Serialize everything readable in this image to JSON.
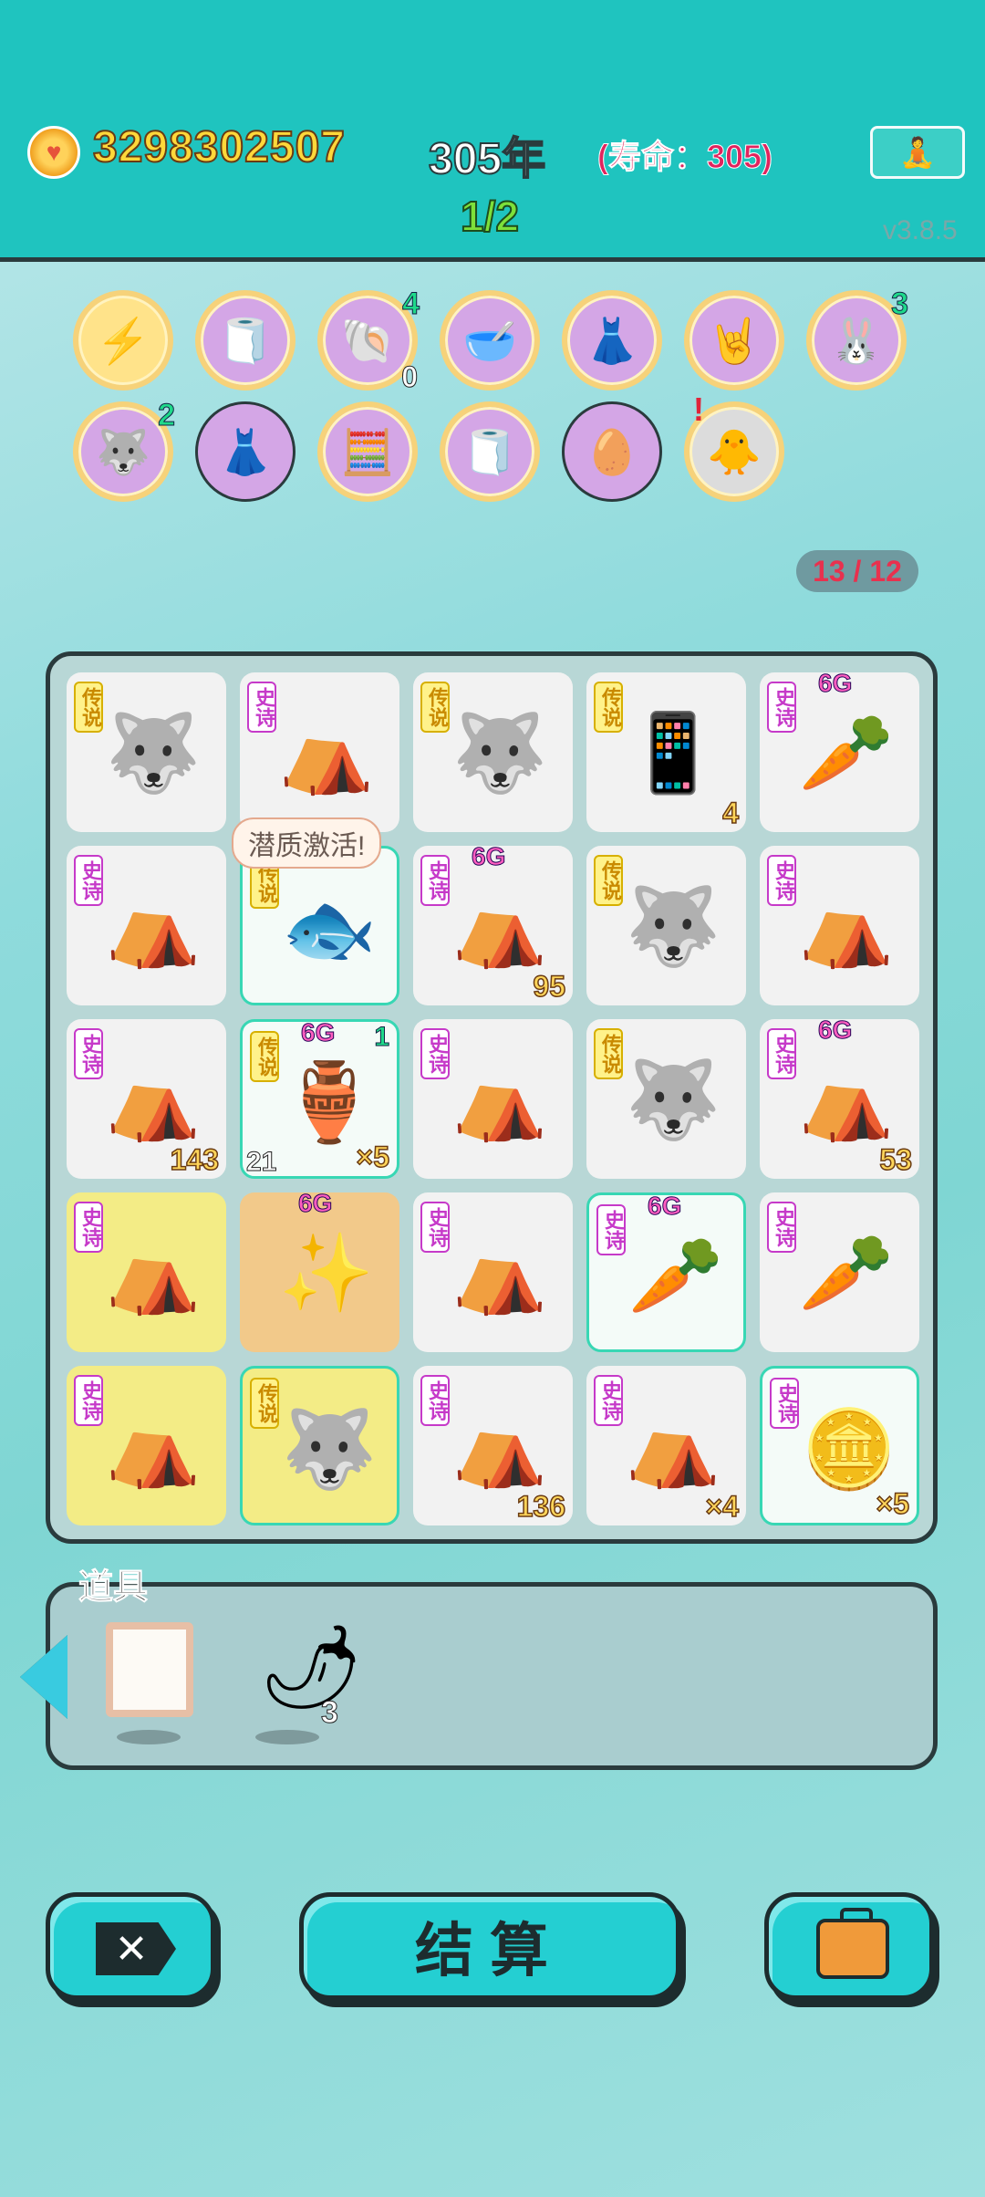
{
  "header": {
    "coins": "3298302507",
    "years": "305年",
    "lifespan": "(寿命：305)",
    "stage": "1/2",
    "version": "v3.8.5",
    "meditate_icon": "meditation-icon"
  },
  "badges": [
    {
      "icon": "lightning-icon",
      "glyph": "⚡",
      "count": "",
      "sub": ""
    },
    {
      "icon": "tissue-box-icon",
      "glyph": "🧻",
      "count": "",
      "sub": ""
    },
    {
      "icon": "shell-icon",
      "glyph": "🐚",
      "count": "4",
      "sub": "0"
    },
    {
      "icon": "bowls-icon",
      "glyph": "🥣",
      "count": "",
      "sub": ""
    },
    {
      "icon": "skirt-icon",
      "glyph": "👗",
      "count": "",
      "sub": ""
    },
    {
      "icon": "rock-hand-icon",
      "glyph": "🤘",
      "count": "",
      "sub": ""
    },
    {
      "icon": "rabbit-icon",
      "glyph": "🐰",
      "count": "3",
      "sub": ""
    },
    {
      "icon": "husky-icon",
      "glyph": "🐺",
      "count": "2",
      "sub": ""
    },
    {
      "icon": "skirt-plain-icon",
      "glyph": "👗",
      "count": "",
      "sub": ""
    },
    {
      "icon": "math-head-icon",
      "glyph": "🧮",
      "count": "",
      "sub": ""
    },
    {
      "icon": "tissue-box-plain-icon",
      "glyph": "🧻",
      "count": "",
      "sub": ""
    },
    {
      "icon": "egg-icon",
      "glyph": "🥚",
      "count": "",
      "sub": ""
    },
    {
      "icon": "chick-icon",
      "glyph": "🐥",
      "count": "",
      "sub": "",
      "alert": "!"
    }
  ],
  "slot_counter": "13 / 12",
  "board": {
    "bubble": "潜质激活!",
    "cells": [
      {
        "tag": "传说",
        "kind": "legend",
        "icon": "husky-king-icon",
        "glyph": "🐺",
        "num": "",
        "g": ""
      },
      {
        "tag": "史诗",
        "kind": "epic",
        "icon": "rabbit-tent-icon",
        "glyph": "⛺",
        "num": "",
        "g": ""
      },
      {
        "tag": "传说",
        "kind": "legend",
        "icon": "husky-king-icon",
        "glyph": "🐺",
        "num": "",
        "g": ""
      },
      {
        "tag": "传说",
        "kind": "legend",
        "icon": "phone-icon",
        "glyph": "📱",
        "num": "4",
        "g": ""
      },
      {
        "tag": "史诗",
        "kind": "epic",
        "icon": "carrot-icon",
        "glyph": "🥕",
        "num": "",
        "g": "6G"
      },
      {
        "tag": "史诗",
        "kind": "epic",
        "icon": "rabbit-tent-icon",
        "glyph": "⛺",
        "num": "",
        "g": ""
      },
      {
        "tag": "传说",
        "kind": "legend",
        "icon": "koi-fish-icon",
        "glyph": "🐟",
        "num": "",
        "g": "",
        "hl": true
      },
      {
        "tag": "史诗",
        "kind": "epic",
        "icon": "rabbit-tent-icon",
        "glyph": "⛺",
        "num": "95",
        "g": "6G"
      },
      {
        "tag": "传说",
        "kind": "legend",
        "icon": "husky-moon-icon",
        "glyph": "🐺",
        "num": "",
        "g": ""
      },
      {
        "tag": "史诗",
        "kind": "epic",
        "icon": "rabbit-tent-icon",
        "glyph": "⛺",
        "num": "",
        "g": ""
      },
      {
        "tag": "史诗",
        "kind": "epic",
        "icon": "rabbit-tent-icon",
        "glyph": "⛺",
        "num": "143",
        "g": ""
      },
      {
        "tag": "传说",
        "kind": "legend",
        "icon": "green-vase-icon",
        "glyph": "🏺",
        "num": "×5",
        "g": "6G",
        "tl": "21",
        "tr": "1",
        "hl": true
      },
      {
        "tag": "史诗",
        "kind": "epic",
        "icon": "rabbit-tent-icon",
        "glyph": "⛺",
        "num": "",
        "g": ""
      },
      {
        "tag": "传说",
        "kind": "legend",
        "icon": "husky-king-icon",
        "glyph": "🐺",
        "num": "",
        "g": ""
      },
      {
        "tag": "史诗",
        "kind": "epic",
        "icon": "rabbit-tent-icon",
        "glyph": "⛺",
        "num": "53",
        "g": "6G"
      },
      {
        "tag": "史诗",
        "kind": "epic",
        "icon": "rabbit-tent-big-icon",
        "glyph": "⛺",
        "num": "",
        "g": "",
        "bg": "yellow"
      },
      {
        "tag": "",
        "kind": "",
        "icon": "sparkle-cross-icon",
        "glyph": "✨",
        "num": "",
        "g": "6G",
        "bg": "orange"
      },
      {
        "tag": "史诗",
        "kind": "epic",
        "icon": "rabbit-tent-icon",
        "glyph": "⛺",
        "num": "",
        "g": ""
      },
      {
        "tag": "史诗",
        "kind": "epic",
        "icon": "carrot-icon",
        "glyph": "🥕",
        "num": "",
        "g": "6G",
        "hl": true
      },
      {
        "tag": "史诗",
        "kind": "epic",
        "icon": "carrot-coin-icon",
        "glyph": "🥕",
        "num": "",
        "g": ""
      },
      {
        "tag": "史诗",
        "kind": "epic",
        "icon": "rabbit-tent-big-icon",
        "glyph": "⛺",
        "num": "",
        "g": "",
        "bg": "yellow"
      },
      {
        "tag": "传说",
        "kind": "legend",
        "icon": "husky-big-icon",
        "glyph": "🐺",
        "num": "",
        "g": "",
        "bg": "yellow",
        "hl": true
      },
      {
        "tag": "史诗",
        "kind": "epic",
        "icon": "rabbit-tent-icon",
        "glyph": "⛺",
        "num": "136",
        "g": ""
      },
      {
        "tag": "史诗",
        "kind": "epic",
        "icon": "rabbit-tent-moon-icon",
        "glyph": "⛺",
        "num": "×4",
        "g": ""
      },
      {
        "tag": "史诗",
        "kind": "epic",
        "icon": "coin-pile-icon",
        "glyph": "🪙",
        "num": "×5",
        "g": "",
        "hl": true
      }
    ]
  },
  "items": {
    "title": "道具",
    "slot2_count": "3",
    "slot1_icon": "frame-icon",
    "slot2_icon": "chili-pepper-icon",
    "slot2_glyph": "🌶"
  },
  "buttons": {
    "settle": "结算",
    "close_icon": "close-icon",
    "close_glyph": "✕",
    "bag_icon": "briefcase-icon"
  }
}
